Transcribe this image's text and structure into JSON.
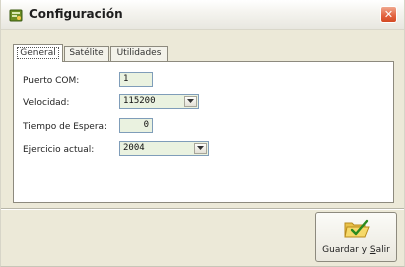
{
  "window": {
    "title": "Configuración",
    "close_glyph": "✕",
    "icons": {
      "app": "app-icon",
      "close": "close-icon"
    },
    "accent_color": "#e2613e"
  },
  "tabs": [
    {
      "label": "General",
      "active": true
    },
    {
      "label": "Satélite",
      "active": false
    },
    {
      "label": "Utilidades",
      "active": false
    }
  ],
  "form": {
    "puerto_com": {
      "label": "Puerto COM:",
      "value": "1"
    },
    "velocidad": {
      "label": "Velocidad:",
      "value": "115200"
    },
    "tiempo_espera": {
      "label": "Tiempo de Espera:",
      "value": "0"
    },
    "ejercicio_actual": {
      "label": "Ejercicio actual:",
      "value": "2004"
    }
  },
  "actions": {
    "save": {
      "label_prefix": "Guardar y ",
      "label_underlined": "S",
      "label_suffix": "alir",
      "icon": "folder-check-icon"
    }
  }
}
